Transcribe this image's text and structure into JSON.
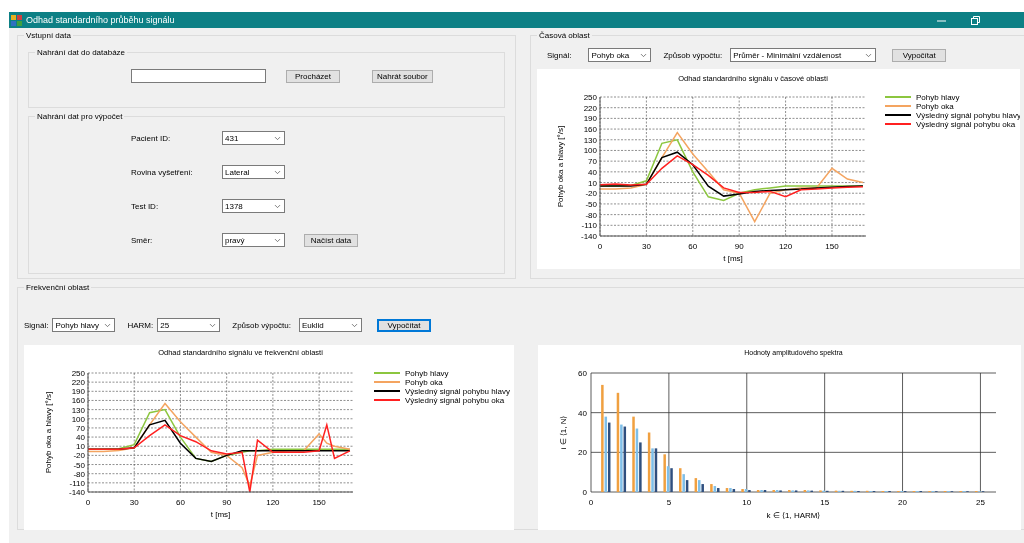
{
  "window": {
    "title": "Odhad standardního průběhu signálu"
  },
  "input_data": {
    "title": "Vstupní data",
    "upload": {
      "title": "Nahrání dat do databáze",
      "buttons": [
        {
          "label": "Procházet"
        },
        {
          "label": "Nahrát soubor"
        }
      ]
    },
    "load": {
      "title": "Nahrání dat pro výpočet",
      "fields": [
        {
          "label": "Pacient ID:",
          "value": "431"
        },
        {
          "label": "Rovina vyšetření:",
          "value": "Lateral"
        },
        {
          "label": "Test ID:",
          "value": "1378"
        },
        {
          "label": "Směr:",
          "value": "pravý"
        }
      ],
      "button": {
        "label": "Načíst data"
      }
    }
  },
  "time_domain": {
    "title": "Časová oblast",
    "controls": [
      {
        "label": "Signál:",
        "value": "Pohyb oka"
      },
      {
        "label": "Způsob výpočtu:",
        "value": "Průměr - Minimální vzdálenost"
      }
    ],
    "button": {
      "label": "Vypočítat",
      "focused": false
    },
    "chart_data": {
      "type": "line",
      "title": "Odhad standardního signálu v časové oblasti",
      "xlabel": "t [ms]",
      "ylabel": "Pohyb oka a hlavy [°/s]",
      "grid": true,
      "legend": true,
      "x": [
        0,
        10,
        20,
        30,
        40,
        50,
        60,
        70,
        80,
        90,
        100,
        110,
        120,
        130,
        140,
        150,
        160,
        170
      ],
      "xlim": [
        0,
        172
      ],
      "ylim": [
        -140,
        250
      ],
      "xticks": [
        0,
        30,
        60,
        90,
        120,
        150
      ],
      "yticks": [
        -140,
        -110,
        -80,
        -50,
        -20,
        10,
        40,
        70,
        100,
        130,
        160,
        190,
        220,
        250
      ],
      "series": [
        {
          "name": "Pohyb hlavy",
          "color": "#8cc63f",
          "values": [
            0,
            0,
            2,
            15,
            120,
            130,
            40,
            -30,
            -40,
            -20,
            -10,
            -5,
            0,
            0,
            0,
            0,
            0,
            0
          ]
        },
        {
          "name": "Pohyb oka",
          "color": "#f4a460",
          "values": [
            -8,
            -8,
            -5,
            5,
            80,
            150,
            90,
            40,
            -10,
            -20,
            -100,
            -20,
            -10,
            -5,
            -5,
            50,
            20,
            10
          ]
        },
        {
          "name": "Výsledný signál pohybu hlavy",
          "color": "#000000",
          "values": [
            0,
            0,
            0,
            5,
            80,
            95,
            60,
            0,
            -28,
            -22,
            -15,
            -12,
            -10,
            -8,
            -5,
            -3,
            -1,
            0
          ]
        },
        {
          "name": "Výsledný signál pohybu oka",
          "color": "#ff2020",
          "values": [
            4,
            6,
            3,
            5,
            50,
            85,
            60,
            30,
            -5,
            -18,
            -18,
            -15,
            -30,
            -10,
            -8,
            -5,
            -3,
            -2
          ]
        }
      ]
    }
  },
  "frequency_domain": {
    "title": "Frekvenční oblast",
    "controls": [
      {
        "label": "Signál:",
        "value": "Pohyb hlavy"
      },
      {
        "label": "HARM:",
        "value": "25"
      },
      {
        "label": "Způsob výpočtu:",
        "value": "Euklid"
      }
    ],
    "button": {
      "label": "Vypočítat",
      "focused": true
    },
    "charts": [
      {
        "chart_data": {
          "type": "line",
          "title": "Odhad standardního signálu ve frekvenční oblasti",
          "xlabel": "t [ms]",
          "ylabel": "Pohyb oka a hlavy [°/s]",
          "grid": true,
          "legend": true,
          "x": [
            0,
            10,
            20,
            30,
            40,
            50,
            60,
            70,
            80,
            90,
            100,
            105,
            110,
            120,
            130,
            140,
            150,
            155,
            160,
            170
          ],
          "xlim": [
            0,
            172
          ],
          "ylim": [
            -140,
            250
          ],
          "xticks": [
            0,
            30,
            60,
            90,
            120,
            150
          ],
          "yticks": [
            -140,
            -110,
            -80,
            -50,
            -20,
            10,
            40,
            70,
            100,
            130,
            160,
            190,
            220,
            250
          ],
          "series": [
            {
              "name": "Pohyb hlavy",
              "color": "#8cc63f",
              "values": [
                0,
                0,
                2,
                15,
                120,
                130,
                40,
                -30,
                -40,
                -20,
                -10,
                -5,
                -5,
                0,
                0,
                0,
                0,
                0,
                0,
                0
              ]
            },
            {
              "name": "Pohyb oka",
              "color": "#f4a460",
              "values": [
                -7,
                -7,
                -4,
                5,
                80,
                150,
                90,
                40,
                -10,
                -20,
                -60,
                -120,
                -20,
                -10,
                -5,
                -5,
                50,
                20,
                10,
                0
              ]
            },
            {
              "name": "Výsledný signál pohybu hlavy",
              "color": "#000000",
              "values": [
                0,
                0,
                0,
                5,
                80,
                95,
                20,
                -30,
                -40,
                -20,
                -5,
                -5,
                -5,
                -5,
                -5,
                -5,
                -5,
                -5,
                -5,
                -5
              ]
            },
            {
              "name": "Výsledný signál pohybu oka",
              "color": "#ff2020",
              "values": [
                0,
                0,
                0,
                5,
                45,
                80,
                45,
                25,
                -5,
                -15,
                -10,
                -140,
                30,
                -10,
                -10,
                -10,
                -5,
                80,
                -30,
                -5
              ]
            }
          ]
        }
      },
      {
        "chart_data": {
          "type": "bar",
          "title": "Hodnoty amplitudového spektra",
          "xlabel": "k ∈ ⟨1, HARM⟩",
          "ylabel": "i ∈ ⟨1, N⟩",
          "grid": true,
          "x": [
            1,
            2,
            3,
            4,
            5,
            6,
            7,
            8,
            9,
            10,
            11,
            12,
            13,
            14,
            15,
            16,
            17,
            18,
            19,
            20,
            21,
            22,
            23,
            24,
            25
          ],
          "xlim": [
            0,
            26
          ],
          "ylim": [
            0,
            60
          ],
          "xticks": [
            0,
            5,
            10,
            15,
            20,
            25
          ],
          "yticks": [
            0,
            20,
            40,
            60
          ],
          "series": [
            {
              "color": "#f0a040",
              "values": [
                54,
                50,
                38,
                30,
                19,
                12,
                7,
                4,
                2,
                1.5,
                1,
                1,
                1,
                1,
                0.8,
                0.7,
                0.6,
                0.6,
                0.5,
                0.5,
                0.5,
                0.5,
                0.5,
                0.5,
                0.5
              ]
            },
            {
              "color": "#7fbfe8",
              "values": [
                38,
                34,
                32,
                22,
                13,
                9,
                6,
                3,
                2,
                1.5,
                1,
                1,
                0.8,
                0.8,
                0.7,
                0.6,
                0.6,
                0.5,
                0.5,
                0.5,
                0.5,
                0.5,
                0.5,
                0.5,
                0.4
              ]
            },
            {
              "color": "#2f4f7f",
              "values": [
                35,
                33,
                25,
                22,
                12,
                6,
                4,
                2,
                1.5,
                1,
                1,
                0.8,
                0.8,
                0.7,
                0.6,
                0.6,
                0.5,
                0.5,
                0.5,
                0.5,
                0.5,
                0.4,
                0.4,
                0.4,
                0.4
              ]
            }
          ]
        }
      }
    ]
  }
}
